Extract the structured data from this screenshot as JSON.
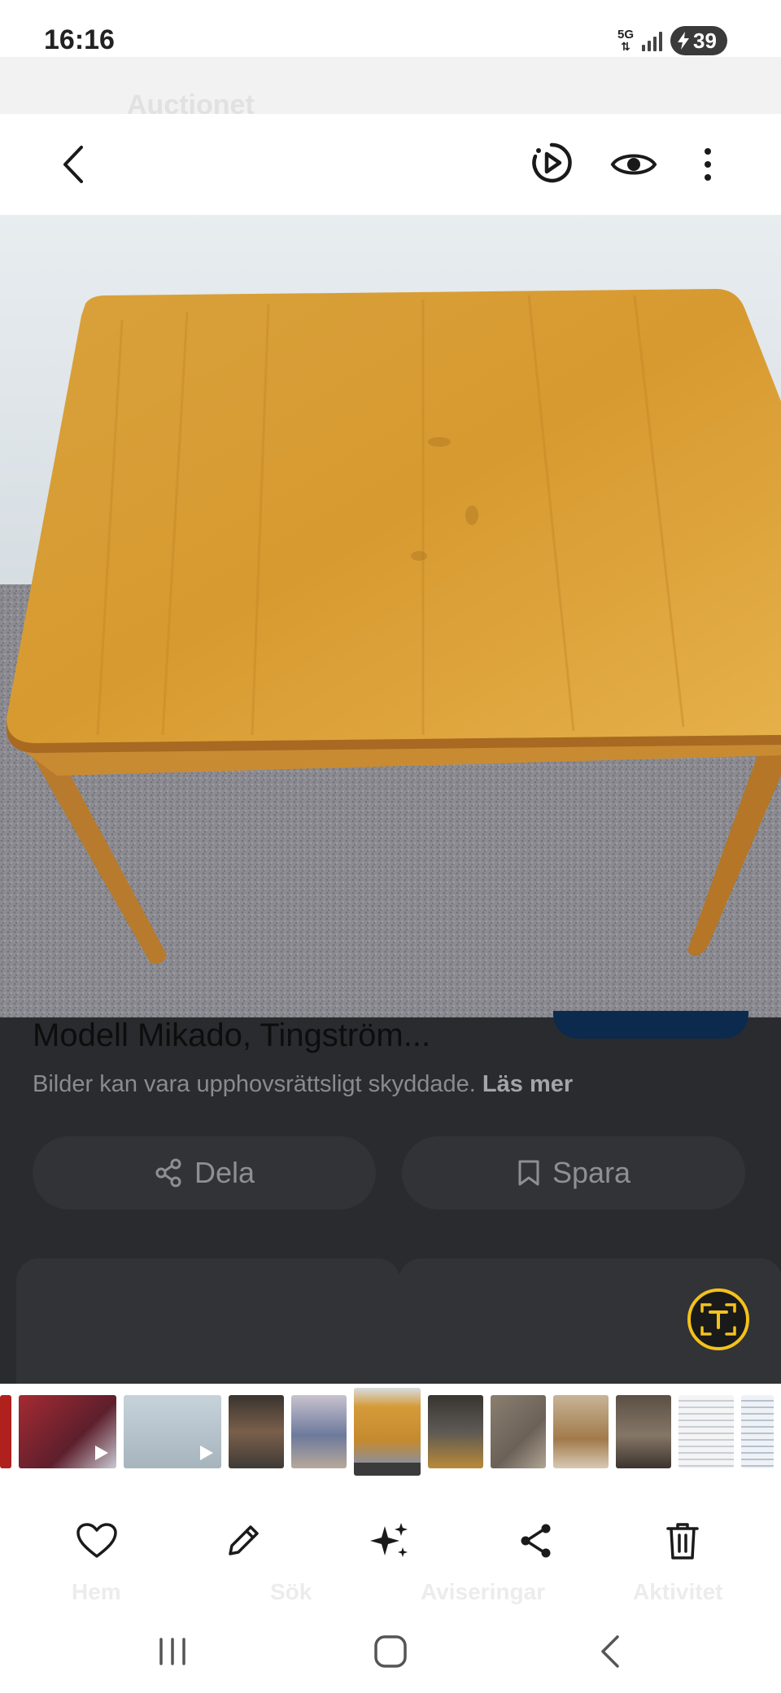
{
  "status": {
    "time": "16:16",
    "network": "5G",
    "battery": "39"
  },
  "background_page": {
    "header_title": "Auctionet",
    "bottom_nav": [
      "Hem",
      "Sök",
      "Aviseringar",
      "Aktivitet"
    ]
  },
  "viewer": {
    "back_icon": "arrow-left-icon",
    "motion_icon": "motion-photo-icon",
    "view_icon": "eye-icon",
    "more_icon": "more-vert-icon"
  },
  "result": {
    "title": "Modell Mikado, Tingström...",
    "copyright_text": "Bilder kan vara upphovsrättsligt skyddade.",
    "copyright_link": "Läs mer",
    "share_label": "Dela",
    "save_label": "Spara"
  },
  "thumbnails": [
    {
      "kind": "video",
      "color": "#b0201c"
    },
    {
      "kind": "video",
      "color": "#8a2a35"
    },
    {
      "kind": "video",
      "color": "#b9c6cf"
    },
    {
      "kind": "photo",
      "color": "#5b4a3c"
    },
    {
      "kind": "photo",
      "color": "#8c8aa2"
    },
    {
      "kind": "photo",
      "color": "#d59b3a",
      "active": true
    },
    {
      "kind": "photo",
      "color": "#4d4943"
    },
    {
      "kind": "photo",
      "color": "#7d7163"
    },
    {
      "kind": "photo",
      "color": "#a08a6e"
    },
    {
      "kind": "photo",
      "color": "#6d625a"
    },
    {
      "kind": "photo",
      "color": "#8f8f8f"
    },
    {
      "kind": "photo",
      "color": "#f1f1f1"
    },
    {
      "kind": "photo",
      "color": "#e9eef4"
    }
  ],
  "bottom_actions": [
    "heart-icon",
    "edit-icon",
    "sparkle-icon",
    "share-icon",
    "trash-icon"
  ],
  "navigation": [
    "recents-icon",
    "home-icon",
    "back-icon"
  ]
}
